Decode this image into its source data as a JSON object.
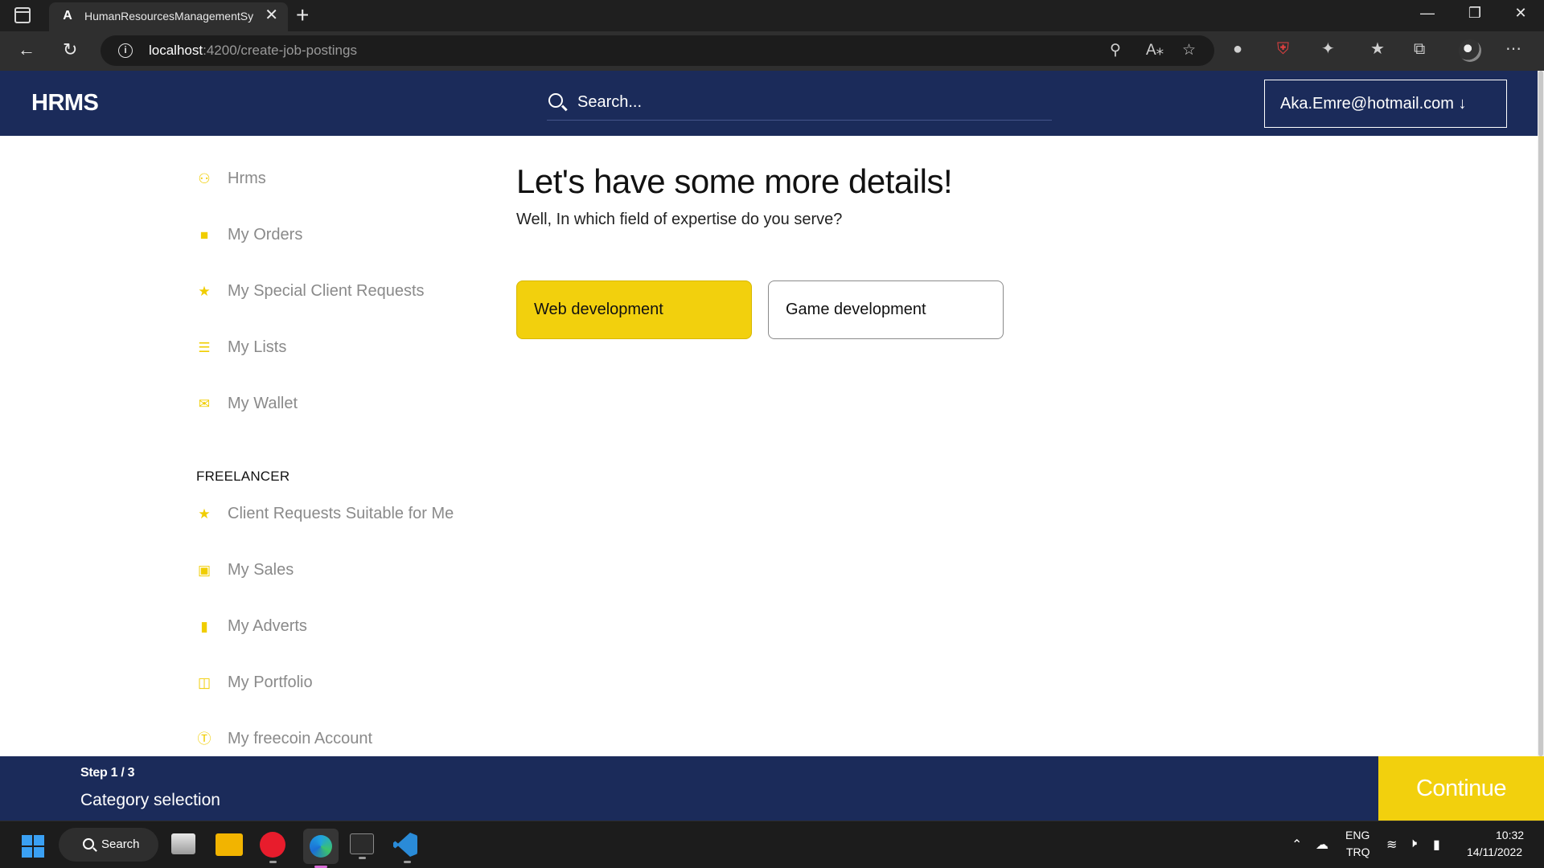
{
  "browser": {
    "tab_title": "HumanResourcesManagementSy",
    "tab_favicon": "A",
    "tab_close": "✕",
    "new_tab": "+",
    "url_host": "localhost",
    "url_path": ":4200/create-job-postings",
    "window_controls": [
      "—",
      "❐",
      "✕"
    ],
    "icons": [
      "back-icon",
      "refresh-icon",
      "info-icon",
      "key-icon",
      "read-aloud-icon",
      "add-favorite-icon",
      "extension-icon",
      "shield-extension-icon",
      "puzzle-icon",
      "favorites-icon",
      "collections-icon",
      "profile-icon",
      "more-icon"
    ]
  },
  "header": {
    "brand": "HRMS",
    "search_placeholder": "Search...",
    "user_email": "Aka.Emre@hotmail.com ↓"
  },
  "sidebar": {
    "items": [
      {
        "label": "Hrms",
        "icon": "users-icon"
      },
      {
        "label": "My Orders",
        "icon": "bag-icon"
      },
      {
        "label": "My Special Client Requests",
        "icon": "star-icon"
      },
      {
        "label": "My Lists",
        "icon": "list-icon"
      },
      {
        "label": "My Wallet",
        "icon": "wallet-icon"
      }
    ],
    "section_title": "FREELANCER",
    "freelancer_items": [
      {
        "label": "Client Requests Suitable for Me",
        "icon": "star-icon"
      },
      {
        "label": "My Sales",
        "icon": "store-icon"
      },
      {
        "label": "My Adverts",
        "icon": "document-icon"
      },
      {
        "label": "My Portfolio",
        "icon": "book-icon"
      },
      {
        "label": "My freecoin Account",
        "icon": "coin-icon"
      }
    ]
  },
  "main": {
    "title": "Let's have some more details!",
    "subtitle": "Well, In which field of expertise do you serve?",
    "options": [
      {
        "label": "Web development",
        "selected": true
      },
      {
        "label": "Game development",
        "selected": false
      }
    ]
  },
  "stepbar": {
    "step_count": "Step 1 / 3",
    "step_name": "Category selection",
    "continue_label": "Continue"
  },
  "taskbar": {
    "search_label": "Search",
    "lang_top": "ENG",
    "lang_bottom": "TRQ",
    "time": "10:32",
    "date": "14/11/2022"
  },
  "colors": {
    "navy": "#1b2b5a",
    "accent_yellow": "#f2d00d",
    "sidebar_text": "#8a8a8a"
  }
}
